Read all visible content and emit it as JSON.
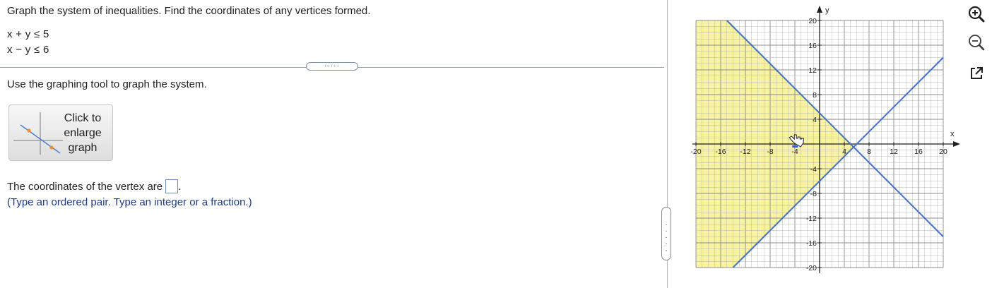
{
  "question": {
    "prompt": "Graph the system of inequalities. Find the coordinates of any vertices formed.",
    "inequalities": [
      "x + y ≤ 5",
      "x − y ≤ 6"
    ],
    "instruction": "Use the graphing tool to graph the system.",
    "splitter_handle": "·····",
    "enlarge_button": {
      "line1": "Click to",
      "line2": "enlarge",
      "line3": "graph"
    },
    "answer_prefix": "The coordinates of the vertex are",
    "answer_value": "",
    "answer_suffix": ".",
    "hint": "(Type an ordered pair. Type an integer or a fraction.)"
  },
  "graph": {
    "x_axis_label": "x",
    "y_axis_label": "y",
    "x_range": [
      -20,
      20
    ],
    "y_range": [
      -20,
      20
    ],
    "x_tick_labels": [
      "-20",
      "-16",
      "-12",
      "-8",
      "-4",
      "4",
      "8",
      "12",
      "16",
      "20"
    ],
    "y_tick_labels": [
      "20",
      "16",
      "12",
      "8",
      "4",
      "-4",
      "-8",
      "-12",
      "-16",
      "-20"
    ],
    "lines": [
      {
        "equation": "x + y = 5",
        "color": "#3f6fd8"
      },
      {
        "equation": "x - y = 6",
        "color": "#3f6fd8"
      }
    ],
    "shaded_region_color": "#f7f3a1",
    "grid": true
  },
  "tools": {
    "zoom_in": "zoom-in",
    "zoom_out": "zoom-out",
    "popout": "open-in-new-window"
  },
  "colors": {
    "accent": "#3f6fd8",
    "link_text": "#1b3a8c",
    "shade": "#f7f3a1"
  }
}
